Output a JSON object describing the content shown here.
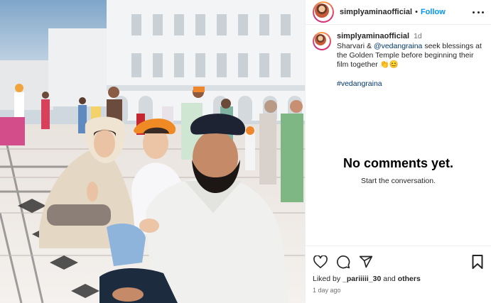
{
  "header": {
    "username": "simplyaminaofficial",
    "separator": "•",
    "follow_label": "Follow"
  },
  "caption": {
    "username": "simplyaminaofficial",
    "time": "1d",
    "text_part1": "Sharvari & ",
    "mention": "@vedangraina",
    "text_part2": " seek blessings at the Golden Temple before beginning their film together ",
    "emojis": "👏😊",
    "hashtag": "#vedangraina"
  },
  "comments": {
    "empty_title": "No comments yet.",
    "empty_subtitle": "Start the conversation."
  },
  "actions": {
    "icons": [
      "heart-icon",
      "comment-icon",
      "share-icon",
      "bookmark-icon"
    ],
    "liked_by_prefix": "Liked by ",
    "liked_by_user": "_pariiiii_30",
    "liked_by_middle": " and ",
    "liked_by_others": "others",
    "time_ago": "1 day ago"
  },
  "colors": {
    "accent": "#0095f6",
    "link": "#00376b",
    "muted": "#737373"
  }
}
